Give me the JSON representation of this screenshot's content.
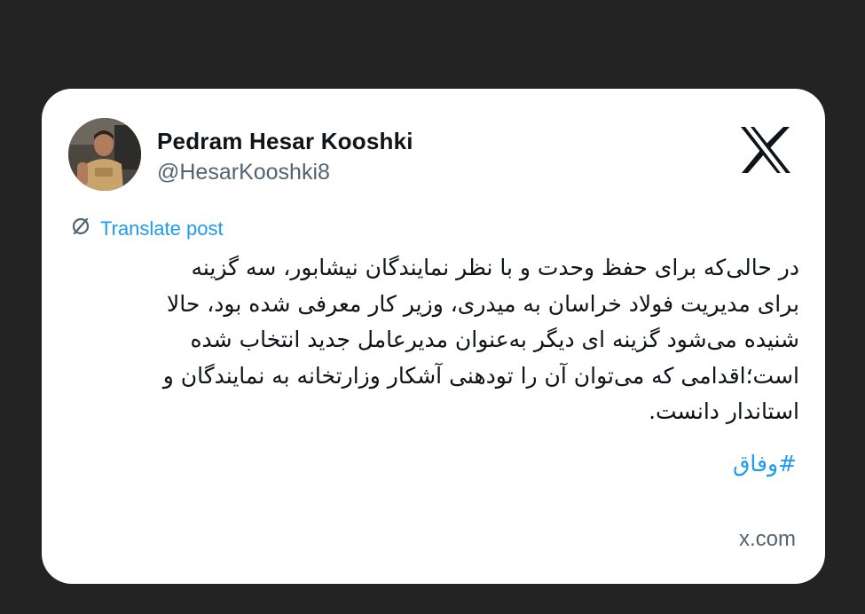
{
  "author": {
    "name": "Pedram Hesar Kooshki",
    "handle": "@HesarKooshki8"
  },
  "brand_icon": "x-logo-icon",
  "translate": {
    "icon": "translate-icon",
    "label": "Translate post"
  },
  "post": {
    "lines": [
      "در حالی‌که برای حفظ وحدت و با نظر نمایندگان نیشابور، سه گزینه",
      "برای مدیریت فولاد خراسان به میدری، وزیر کار معرفی شده بود، حالا",
      "شنیده می‌شود گزینه ای دیگر به‌عنوان مدیرعامل جدید انتخاب شده",
      "است؛اقدامی که می‌توان آن را تودهنی آشکار وزارتخانه به نمایندگان و",
      "استاندار دانست."
    ],
    "hashtag": "#وفاق"
  },
  "footer": {
    "domain": "x.com"
  },
  "colors": {
    "background": "#232323",
    "card": "#ffffff",
    "text": "#0f1419",
    "muted": "#536471",
    "link": "#1d9bf0"
  }
}
